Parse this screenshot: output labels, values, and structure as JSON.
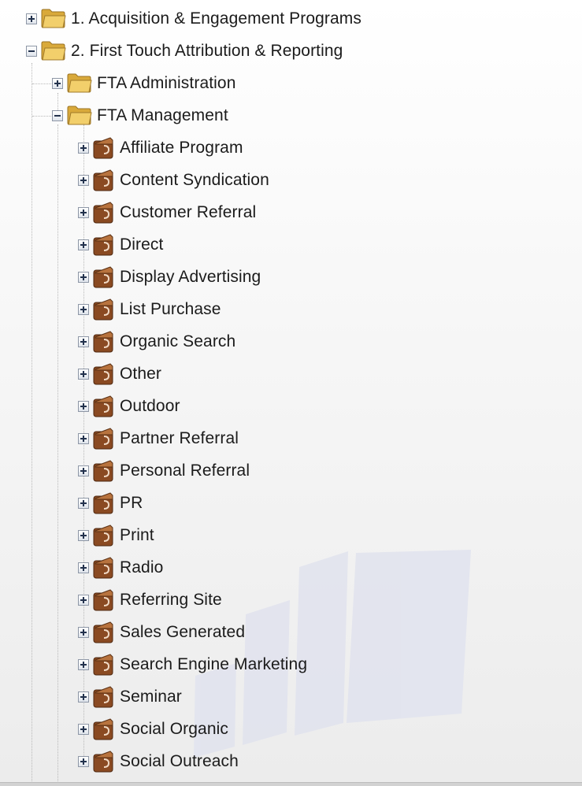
{
  "tree": {
    "programs": {
      "label": "1. Acquisition & Engagement Programs",
      "expanded": false,
      "icon": "folder-icon"
    },
    "fta": {
      "label": "2. First Touch Attribution & Reporting",
      "expanded": true,
      "icon": "folder-icon",
      "children": [
        {
          "label": "FTA Administration",
          "expanded": false,
          "icon": "folder-icon"
        },
        {
          "label": "FTA Management",
          "expanded": true,
          "icon": "folder-icon"
        }
      ]
    },
    "channels": [
      {
        "label": "Affiliate Program"
      },
      {
        "label": "Content Syndication"
      },
      {
        "label": "Customer Referral"
      },
      {
        "label": "Direct"
      },
      {
        "label": "Display Advertising"
      },
      {
        "label": "List Purchase"
      },
      {
        "label": "Organic Search"
      },
      {
        "label": "Other"
      },
      {
        "label": "Outdoor"
      },
      {
        "label": "Partner Referral"
      },
      {
        "label": "Personal Referral"
      },
      {
        "label": "PR"
      },
      {
        "label": "Print"
      },
      {
        "label": "Radio"
      },
      {
        "label": "Referring Site"
      },
      {
        "label": "Sales Generated"
      },
      {
        "label": "Search Engine Marketing"
      },
      {
        "label": "Seminar"
      },
      {
        "label": "Social Organic"
      },
      {
        "label": "Social Outreach"
      }
    ],
    "channel_icon": "channel-folder-icon"
  },
  "colors": {
    "folder_fill": "#f2cf6b",
    "channel_icon": "#8a4a22",
    "watermark": "#e1e3ee"
  }
}
